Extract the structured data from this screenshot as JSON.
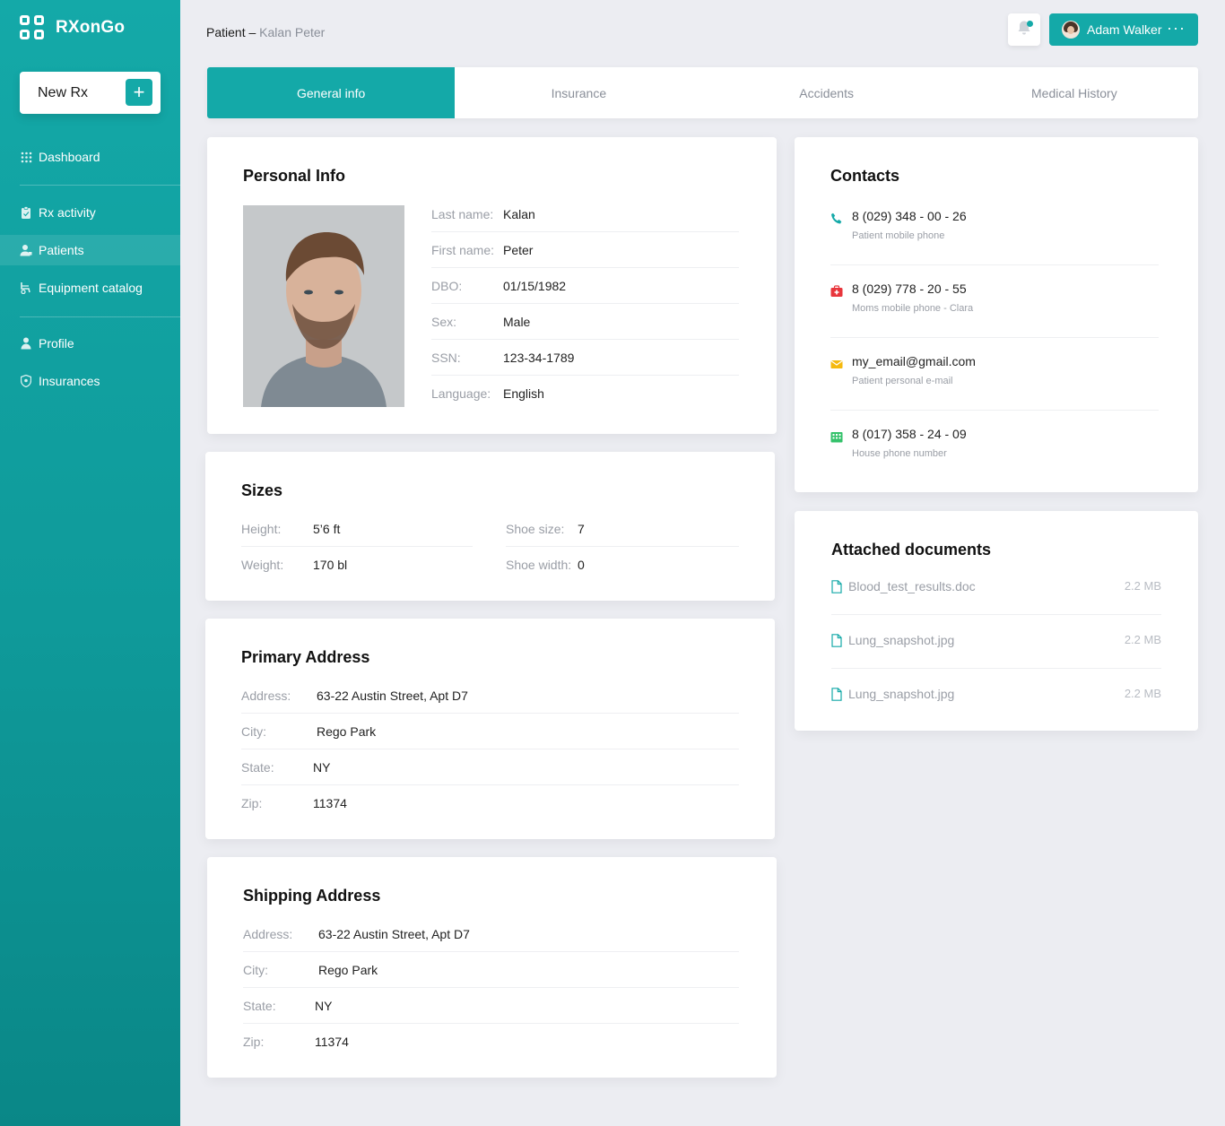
{
  "app": {
    "name": "RXonGo",
    "new_rx_label": "New Rx"
  },
  "nav": {
    "items": [
      {
        "label": "Dashboard",
        "icon": "grid-icon"
      },
      {
        "label": "Rx activity",
        "icon": "clipboard-icon"
      },
      {
        "label": "Patients",
        "icon": "patient-icon"
      },
      {
        "label": "Equipment catalog",
        "icon": "wheelchair-icon"
      },
      {
        "label": "Profile",
        "icon": "user-icon"
      },
      {
        "label": "Insurances",
        "icon": "shield-icon"
      }
    ],
    "active": "Patients"
  },
  "breadcrumb": {
    "root": "Patient",
    "sep": "–",
    "current": "Kalan Peter"
  },
  "user": {
    "name": "Adam Walker"
  },
  "tabs": [
    "General info",
    "Insurance",
    "Accidents",
    "Medical History"
  ],
  "personal": {
    "title": "Personal Info",
    "rows": [
      {
        "label": "Last name:",
        "value": "Kalan"
      },
      {
        "label": "First name:",
        "value": "Peter"
      },
      {
        "label": "DBO:",
        "value": "01/15/1982"
      },
      {
        "label": "Sex:",
        "value": "Male"
      },
      {
        "label": "SSN:",
        "value": "123-34-1789"
      },
      {
        "label": "Language:",
        "value": "English"
      }
    ]
  },
  "sizes": {
    "title": "Sizes",
    "left": [
      {
        "label": "Height:",
        "value": "5’6 ft"
      },
      {
        "label": "Weight:",
        "value": "170 bl"
      }
    ],
    "right": [
      {
        "label": "Shoe size:",
        "value": "7"
      },
      {
        "label": "Shoe width:",
        "value": "0"
      }
    ]
  },
  "primary_address": {
    "title": "Primary Address",
    "rows": [
      {
        "label": "Address:",
        "value": "63-22 Austin Street, Apt D7"
      },
      {
        "label": "City:",
        "value": "Rego Park"
      },
      {
        "label": "State:",
        "value": "NY"
      },
      {
        "label": "Zip:",
        "value": "11374"
      }
    ]
  },
  "shipping_address": {
    "title": "Shipping Address",
    "rows": [
      {
        "label": "Address:",
        "value": "63-22 Austin Street, Apt D7"
      },
      {
        "label": "City:",
        "value": "Rego Park"
      },
      {
        "label": "State:",
        "value": "NY"
      },
      {
        "label": "Zip:",
        "value": "11374"
      }
    ]
  },
  "contacts": {
    "title": "Contacts",
    "items": [
      {
        "value": "8 (029) 348 - 00 - 26",
        "sub": "Patient mobile phone",
        "icon": "phone-icon",
        "color": "#14a9a8"
      },
      {
        "value": "8 (029) 778 - 20 - 55",
        "sub": "Moms mobile phone - Clara",
        "icon": "medkit-icon",
        "color": "#e8363c"
      },
      {
        "value": "my_email@gmail.com",
        "sub": "Patient personal e-mail",
        "icon": "mail-icon",
        "color": "#f5b90f"
      },
      {
        "value": "8 (017) 358 - 24 - 09",
        "sub": "House phone number",
        "icon": "building-icon",
        "color": "#34c26b"
      }
    ]
  },
  "documents": {
    "title": "Attached documents",
    "items": [
      {
        "name": "Blood_test_results.doc",
        "size": "2.2 MB"
      },
      {
        "name": "Lung_snapshot.jpg",
        "size": "2.2 MB"
      },
      {
        "name": "Lung_snapshot.jpg",
        "size": "2.2 MB"
      }
    ]
  },
  "colors": {
    "accent": "#14a9a8",
    "background": "#ecedf2"
  }
}
